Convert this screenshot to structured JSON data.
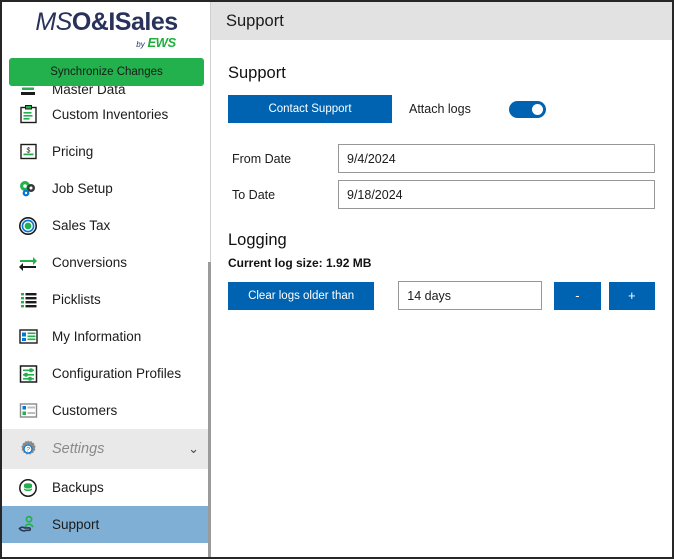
{
  "app": {
    "logo": {
      "part1": "MS",
      "part2": "O&ISales",
      "by": "by",
      "brand": "EWS"
    },
    "sync_button": "Synchronize Changes"
  },
  "sidebar": {
    "items": [
      {
        "label": "Master Data",
        "icon": "master-data-icon",
        "state": "clipped"
      },
      {
        "label": "Custom Inventories",
        "icon": "custom-inventories-icon",
        "state": "normal"
      },
      {
        "label": "Pricing",
        "icon": "pricing-icon",
        "state": "normal"
      },
      {
        "label": "Job Setup",
        "icon": "job-setup-icon",
        "state": "normal"
      },
      {
        "label": "Sales Tax",
        "icon": "sales-tax-icon",
        "state": "normal"
      },
      {
        "label": "Conversions",
        "icon": "conversions-icon",
        "state": "normal"
      },
      {
        "label": "Picklists",
        "icon": "picklists-icon",
        "state": "normal"
      },
      {
        "label": "My Information",
        "icon": "my-information-icon",
        "state": "normal"
      },
      {
        "label": "Configuration Profiles",
        "icon": "configuration-profiles-icon",
        "state": "normal"
      },
      {
        "label": "Customers",
        "icon": "customers-icon",
        "state": "normal"
      }
    ],
    "group": {
      "label": "Settings",
      "icon": "settings-gear-icon",
      "chevron": "⌄"
    },
    "group_items": [
      {
        "label": "Backups",
        "icon": "backups-icon",
        "selected": false
      },
      {
        "label": "Support",
        "icon": "support-icon",
        "selected": true
      }
    ]
  },
  "header": {
    "title": "Support"
  },
  "support": {
    "heading": "Support",
    "contact_button": "Contact Support",
    "attach_logs_label": "Attach logs",
    "attach_logs_on": true,
    "from_date_label": "From Date",
    "from_date_value": "9/4/2024",
    "to_date_label": "To Date",
    "to_date_value": "9/18/2024"
  },
  "logging": {
    "heading": "Logging",
    "log_size": "Current log size: 1.92 MB",
    "clear_button": "Clear logs older than",
    "days_value": "14 days",
    "minus_button": "-",
    "plus_button": "+"
  },
  "colors": {
    "accent_blue": "#0063B1",
    "brand_green": "#22B14C",
    "navy": "#28325A",
    "selected_row": "#7FAFD4",
    "header_gray": "#E2E2E2"
  }
}
